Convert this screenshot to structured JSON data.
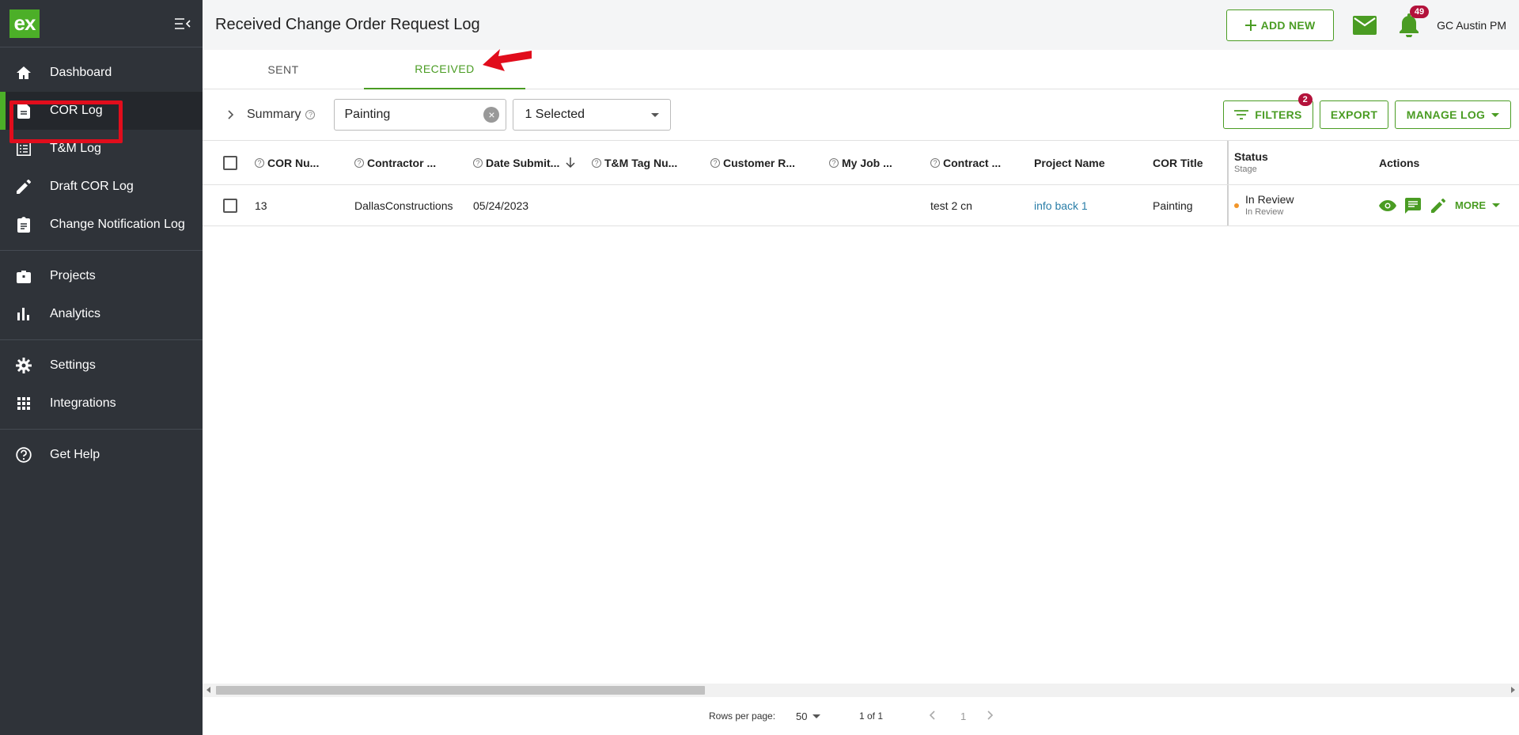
{
  "sidebar": {
    "logo": "ex",
    "items": [
      {
        "label": "Dashboard",
        "icon": "home-icon"
      },
      {
        "label": "COR Log",
        "icon": "document-icon"
      },
      {
        "label": "T&M Log",
        "icon": "list-icon"
      },
      {
        "label": "Draft COR Log",
        "icon": "pencil-icon"
      },
      {
        "label": "Change Notification Log",
        "icon": "clipboard-icon"
      },
      {
        "label": "Projects",
        "icon": "briefcase-icon"
      },
      {
        "label": "Analytics",
        "icon": "bar-chart-icon"
      },
      {
        "label": "Settings",
        "icon": "gear-icon"
      },
      {
        "label": "Integrations",
        "icon": "grid-icon"
      },
      {
        "label": "Get Help",
        "icon": "help-circle-icon"
      }
    ],
    "active_index": 1
  },
  "header": {
    "title": "Received Change Order Request Log",
    "add_new_label": "ADD NEW",
    "notification_count": "49",
    "user_name": "GC Austin PM"
  },
  "tabs": [
    {
      "label": "SENT",
      "active": false
    },
    {
      "label": "RECEIVED",
      "active": true
    }
  ],
  "toolbar": {
    "summary_label": "Summary",
    "search_value": "Painting",
    "select_value": "1 Selected",
    "filters_label": "FILTERS",
    "filters_count": "2",
    "export_label": "EXPORT",
    "manage_label": "MANAGE LOG"
  },
  "table": {
    "columns": [
      "COR Nu...",
      "Contractor ...",
      "Date Submit...",
      "T&M Tag Nu...",
      "Customer R...",
      "My Job ...",
      "Contract ...",
      "Project Name",
      "COR Title",
      "Status",
      "Actions"
    ],
    "status_sub": "Stage",
    "rows": [
      {
        "cor_number": "13",
        "contractor": "DallasConstructions",
        "date_submitted": "05/24/2023",
        "tm_tag": "",
        "customer_ref": "",
        "my_job": "",
        "contract": "test 2 cn",
        "project_name": "info back 1",
        "cor_title": "Painting",
        "status": "In Review",
        "stage": "In Review",
        "more_label": "MORE"
      }
    ]
  },
  "pagination": {
    "rows_per_page_label": "Rows per page:",
    "rows_per_page": "50",
    "range": "1 of 1",
    "page": "1"
  },
  "colors": {
    "brand_green": "#4a9c23",
    "sidebar_bg": "#2f3339",
    "highlight_red": "#e10d1c",
    "badge": "#b3123b",
    "status_dot": "#f2962a"
  }
}
